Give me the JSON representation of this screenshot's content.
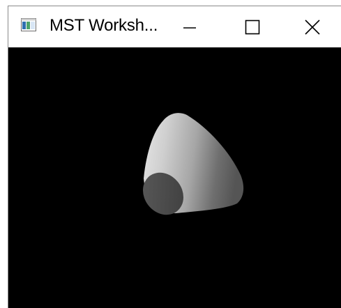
{
  "window": {
    "title": "MST Worksh...",
    "icon": "app-window-icon",
    "controls": {
      "minimize_icon": "minimize-icon",
      "maximize_icon": "maximize-icon",
      "close_icon": "close-icon"
    }
  },
  "viewport": {
    "background": "#000000",
    "object": "shaded-truncated-cone",
    "object_color": "#a0a0a0"
  }
}
